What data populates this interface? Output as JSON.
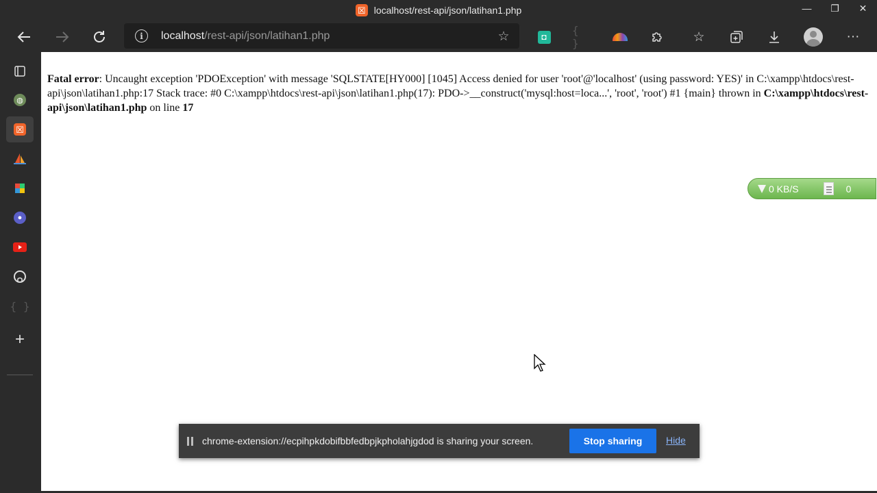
{
  "window": {
    "title": "localhost/rest-api/json/latihan1.php",
    "controls": {
      "minimize": "—",
      "restore": "❐",
      "close": "✕"
    }
  },
  "toolbar": {
    "address": {
      "host": "localhost",
      "path": "/rest-api/json/latihan1.php"
    },
    "icons": [
      "back-arrow-icon",
      "forward-arrow-icon",
      "refresh-icon",
      "info-icon",
      "add-favorite-icon",
      "extension-teal-icon",
      "extension-braces-icon",
      "extension-rainbow-icon",
      "extensions-puzzle-icon",
      "favorites-icon",
      "collections-icon",
      "downloads-icon",
      "profile-avatar-icon",
      "more-menu-icon"
    ]
  },
  "sidebar": {
    "items": [
      {
        "icon": "tab-actions-icon"
      },
      {
        "icon": "globe-site-icon"
      },
      {
        "icon": "xampp-app-icon"
      },
      {
        "icon": "sail-app-icon"
      },
      {
        "icon": "colorful-app-icon"
      },
      {
        "icon": "chromium-app-icon"
      },
      {
        "icon": "youtube-icon"
      },
      {
        "icon": "github-icon"
      },
      {
        "icon": "braces-app-icon"
      },
      {
        "icon": "add-app-icon"
      }
    ]
  },
  "page": {
    "error": {
      "label": "Fatal error",
      "message": ": Uncaught exception 'PDOException' with message 'SQLSTATE[HY000] [1045] Access denied for user 'root'@'localhost' (using password: YES)' in C:\\xampp\\htdocs\\rest-api\\json\\latihan1.php:17 Stack trace: #0 C:\\xampp\\htdocs\\rest-api\\json\\latihan1.php(17): PDO->__construct('mysql:host=loca...', 'root', 'root') #1 {main} thrown in ",
      "file": "C:\\xampp\\htdocs\\rest-api\\json\\latihan1.php",
      "on_line_text": " on line ",
      "line": "17"
    }
  },
  "speed_widget": {
    "speed": "0 KB/S",
    "count": "0"
  },
  "share_bar": {
    "message": "chrome-extension://ecpihpkdobifbbfedbpjkpholahjgdod is sharing your screen.",
    "stop_label": "Stop sharing",
    "hide_label": "Hide"
  },
  "colors": {
    "chrome_bg": "#2b2b2b",
    "address_bg": "#1f1f1f",
    "xampp_orange": "#f0642a",
    "stop_button_blue": "#1a73e8",
    "widget_green": "#6cb64e"
  }
}
